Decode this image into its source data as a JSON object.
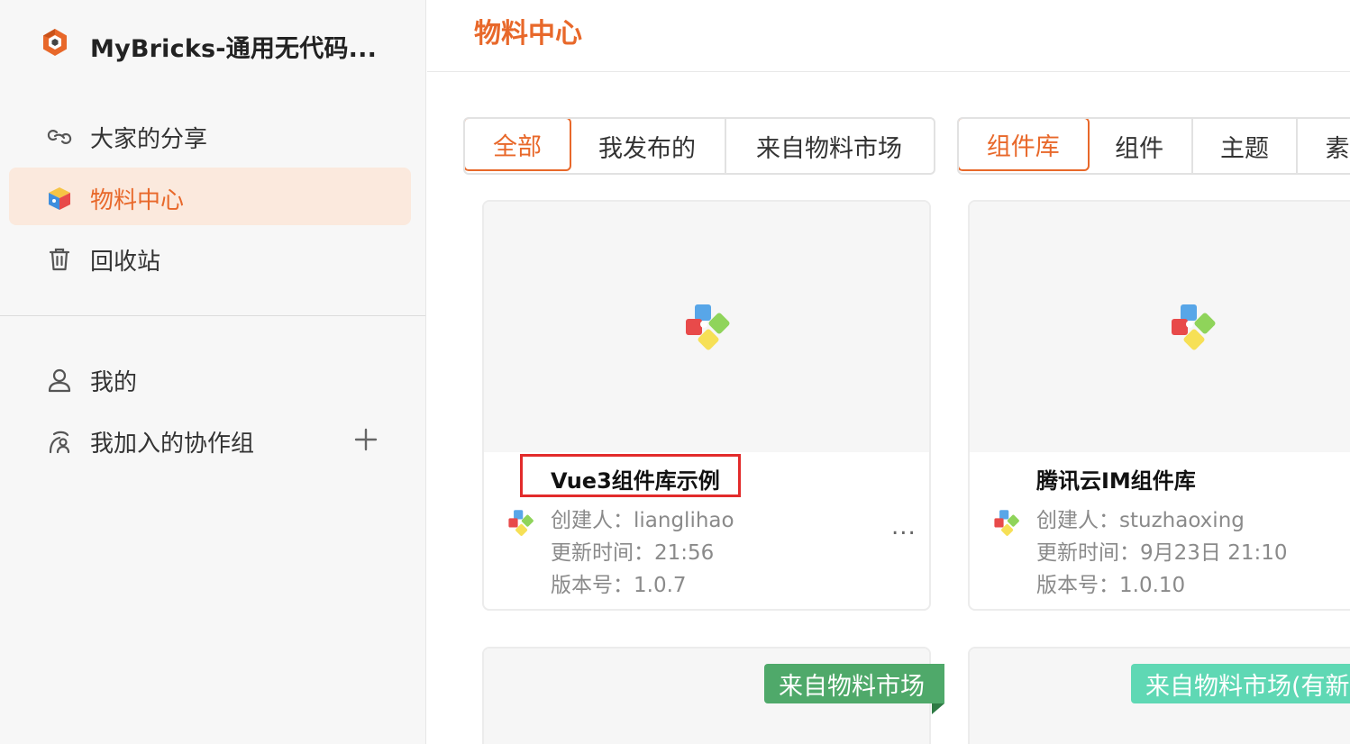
{
  "app": {
    "title": "MyBricks-通用无代码...",
    "logo_icon": "mybricks-logo-icon",
    "accent_color": "#e8682a"
  },
  "sidebar": {
    "items": [
      {
        "label": "大家的分享",
        "icon": "link-icon",
        "active": false
      },
      {
        "label": "物料中心",
        "icon": "material-box-icon",
        "active": true
      },
      {
        "label": "回收站",
        "icon": "trash-icon",
        "active": false
      },
      {
        "label": "我的",
        "icon": "user-icon",
        "active": false
      },
      {
        "label": "我加入的协作组",
        "icon": "group-icon",
        "active": false
      }
    ],
    "add_group_icon": "plus-icon"
  },
  "page": {
    "title": "物料中心"
  },
  "filters": {
    "source_tabs": [
      {
        "label": "全部",
        "active": true
      },
      {
        "label": "我发布的",
        "active": false
      },
      {
        "label": "来自物料市场",
        "active": false
      }
    ],
    "type_tabs": [
      {
        "label": "组件库",
        "active": true
      },
      {
        "label": "组件",
        "active": false
      },
      {
        "label": "主题",
        "active": false
      },
      {
        "label": "素",
        "active": false
      }
    ]
  },
  "cards": [
    {
      "name": "Vue3组件库示例",
      "creator": "创建人：lianglihao",
      "updated": "更新时间：21:56",
      "version": "版本号：1.0.7",
      "more": "...",
      "highlighted": true
    },
    {
      "name": "腾讯云IM组件库",
      "creator": "创建人：stuzhaoxing",
      "updated": "更新时间：9月23日 21:10",
      "version": "版本号：1.0.10"
    },
    {
      "ribbon": "来自物料市场",
      "ribbon_color": "#4fa96a"
    },
    {
      "ribbon": "来自物料市场(有新",
      "ribbon_color": "#5fd8b4"
    }
  ]
}
